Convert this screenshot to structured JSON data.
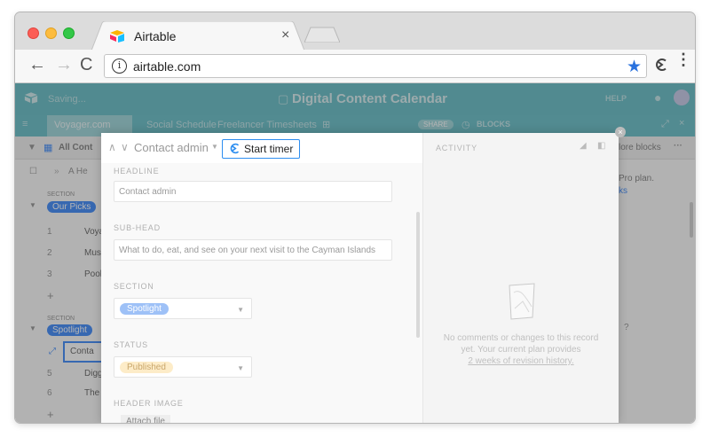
{
  "browser": {
    "tab_title": "Airtable",
    "tab_close": "×",
    "url": "airtable.com",
    "info_glyph": "i",
    "back": "←",
    "forward": "→",
    "reload": "C",
    "star": "★",
    "menu": "⋮"
  },
  "app": {
    "saving": "Saving...",
    "base_title": "Digital Content Calendar",
    "help": "HELP",
    "tabs": [
      "Voyager.com",
      "Social Schedule",
      "Freelancer Timesheets"
    ],
    "share": "SHARE",
    "blocks": "BLOCKS",
    "view_name": "All Cont",
    "more_blocks": "lore blocks",
    "pro_plan_text": "Pro plan.",
    "pro_link": "ks",
    "grid": {
      "sort_hint": "A He",
      "section_label_1": "SECTION",
      "group_1": "Our Picks",
      "rows_1": [
        {
          "num": "1",
          "text": "Voyag"
        },
        {
          "num": "2",
          "text": "Must-"
        },
        {
          "num": "3",
          "text": "Poolsi"
        }
      ],
      "section_label_2": "SECTION",
      "group_2": "Spotlight",
      "rows_2": [
        {
          "num": "",
          "text": "Conta"
        },
        {
          "num": "5",
          "text": "Diggin"
        },
        {
          "num": "6",
          "text": "The co"
        }
      ],
      "plus": "+"
    }
  },
  "record": {
    "name": "Contact admin",
    "start_timer": "Start timer",
    "fields": {
      "headline_label": "HEADLINE",
      "headline_value": "Contact admin",
      "subhead_label": "SUB-HEAD",
      "subhead_value": "What to do, eat, and see on your next visit to the Cayman Islands",
      "section_label": "SECTION",
      "section_value": "Spotlight",
      "status_label": "STATUS",
      "status_value": "Published",
      "header_image_label": "HEADER IMAGE",
      "attach_file": "Attach file"
    },
    "activity": {
      "title": "ACTIVITY",
      "empty_line1": "No comments or changes to this record",
      "empty_line2": "yet. Your current plan provides",
      "empty_line3": "2 weeks of revision history."
    }
  },
  "colors": {
    "accent_teal": "#59b8c1",
    "timer_border": "#2d8ef0",
    "spotlight_tag": "#cfe0ff",
    "published_tag": "#fdecc8",
    "star_blue": "#2a72de"
  }
}
